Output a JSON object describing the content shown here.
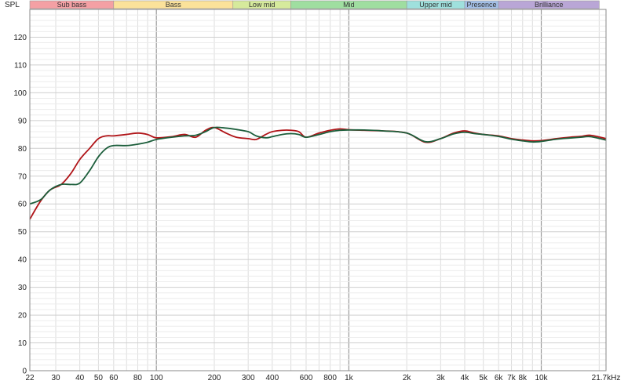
{
  "chart_data": {
    "type": "line",
    "ylabel": "SPL",
    "xscale": "log",
    "xlim": [
      22,
      21700
    ],
    "ylim": [
      0,
      130
    ],
    "grid": true,
    "x_ticks": [
      {
        "value": 22,
        "label": "22"
      },
      {
        "value": 30,
        "label": "30"
      },
      {
        "value": 40,
        "label": "40"
      },
      {
        "value": 50,
        "label": "50"
      },
      {
        "value": 60,
        "label": "60"
      },
      {
        "value": 80,
        "label": "80"
      },
      {
        "value": 100,
        "label": "100"
      },
      {
        "value": 200,
        "label": "200"
      },
      {
        "value": 300,
        "label": "300"
      },
      {
        "value": 400,
        "label": "400"
      },
      {
        "value": 600,
        "label": "600"
      },
      {
        "value": 800,
        "label": "800"
      },
      {
        "value": 1000,
        "label": "1k"
      },
      {
        "value": 2000,
        "label": "2k"
      },
      {
        "value": 3000,
        "label": "3k"
      },
      {
        "value": 4000,
        "label": "4k"
      },
      {
        "value": 5000,
        "label": "5k"
      },
      {
        "value": 6000,
        "label": "6k"
      },
      {
        "value": 7000,
        "label": "7k"
      },
      {
        "value": 8000,
        "label": "8k"
      },
      {
        "value": 10000,
        "label": "10k"
      },
      {
        "value": 21700,
        "label": "21.7kHz"
      }
    ],
    "y_ticks": [
      0,
      10,
      20,
      30,
      40,
      50,
      60,
      70,
      80,
      90,
      100,
      110,
      120
    ],
    "bands": [
      {
        "label": "Sub bass",
        "from": 22,
        "to": 60,
        "color": "#f4a0a4"
      },
      {
        "label": "Bass",
        "from": 60,
        "to": 250,
        "color": "#fbe29a"
      },
      {
        "label": "Low mid",
        "from": 250,
        "to": 500,
        "color": "#d6ea9c"
      },
      {
        "label": "Mid",
        "from": 500,
        "to": 2000,
        "color": "#9fdea0"
      },
      {
        "label": "Upper mid",
        "from": 2000,
        "to": 4000,
        "color": "#9fe0dd"
      },
      {
        "label": "Presence",
        "from": 4000,
        "to": 6000,
        "color": "#a3bfe6"
      },
      {
        "label": "Brilliance",
        "from": 6000,
        "to": 20000,
        "color": "#b9a6d6"
      }
    ],
    "series": [
      {
        "color": "#b01418",
        "x": [
          22,
          25,
          28,
          32,
          36,
          40,
          45,
          50,
          55,
          60,
          70,
          80,
          90,
          100,
          120,
          140,
          160,
          180,
          200,
          230,
          260,
          300,
          330,
          370,
          400,
          450,
          500,
          550,
          600,
          700,
          800,
          900,
          1000,
          1200,
          1500,
          2000,
          2500,
          3000,
          3500,
          4000,
          4500,
          5000,
          6000,
          7000,
          8000,
          9000,
          10000,
          12000,
          14000,
          16000,
          18000,
          21700
        ],
        "y": [
          54.5,
          61,
          65,
          67,
          71,
          76,
          80,
          83.5,
          84.5,
          84.5,
          85,
          85.5,
          85,
          83.8,
          84.2,
          85,
          84,
          86.5,
          87.5,
          85.5,
          84,
          83.5,
          83.2,
          85,
          86,
          86.5,
          86.5,
          86,
          84,
          85.5,
          86.5,
          87,
          86.7,
          86.5,
          86.3,
          85.5,
          82.2,
          83.5,
          85.5,
          86.3,
          85.5,
          85,
          84.5,
          83.5,
          83,
          82.7,
          82.8,
          83.5,
          84,
          84.3,
          84.7,
          83.5
        ]
      },
      {
        "color": "#1c5e3b",
        "x": [
          22,
          25,
          28,
          32,
          36,
          40,
          45,
          50,
          55,
          60,
          70,
          80,
          90,
          100,
          120,
          140,
          160,
          180,
          200,
          230,
          260,
          300,
          330,
          370,
          400,
          450,
          500,
          550,
          600,
          700,
          800,
          900,
          1000,
          1200,
          1500,
          2000,
          2500,
          3000,
          3500,
          4000,
          4500,
          5000,
          6000,
          7000,
          8000,
          9000,
          10000,
          12000,
          14000,
          16000,
          18000,
          21700
        ],
        "y": [
          60,
          61.5,
          65,
          67,
          67,
          67.5,
          72,
          77,
          80,
          81,
          81,
          81.5,
          82.2,
          83.2,
          84,
          84.5,
          84.7,
          86,
          87.5,
          87.3,
          86.8,
          86,
          84.5,
          83.8,
          84.2,
          85,
          85.3,
          85,
          84,
          85,
          86,
          86.5,
          86.6,
          86.6,
          86.3,
          85.5,
          82.4,
          83.5,
          85.2,
          85.8,
          85.3,
          85,
          84.3,
          83.3,
          82.7,
          82.3,
          82.5,
          83.3,
          83.7,
          84,
          84.2,
          83
        ]
      }
    ]
  }
}
